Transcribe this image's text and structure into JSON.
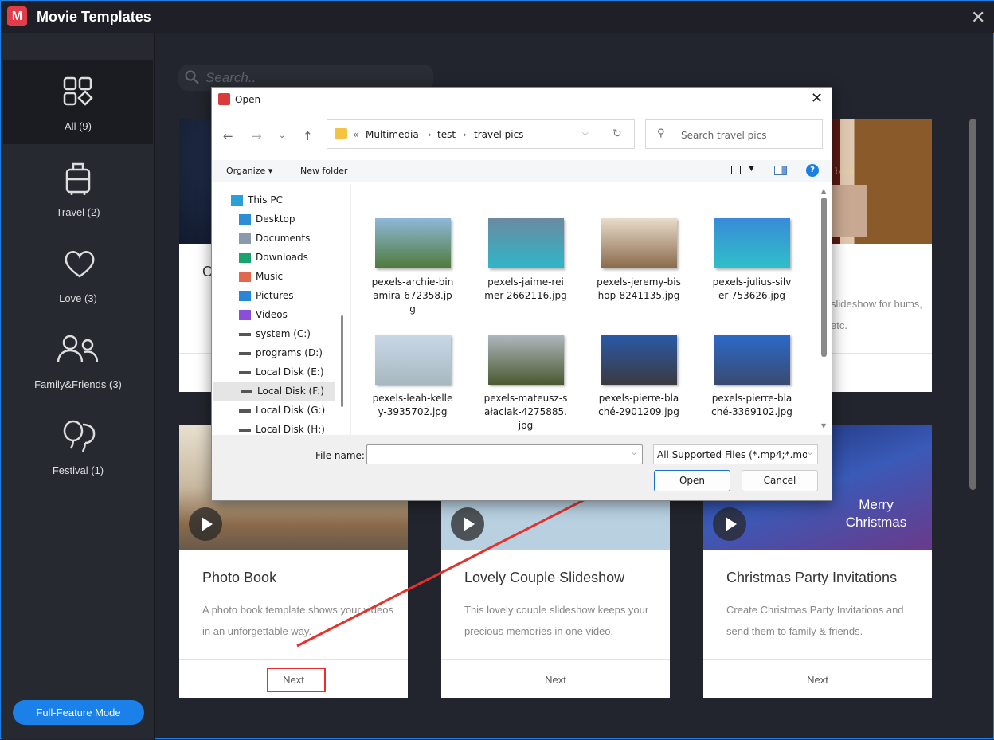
{
  "app": {
    "title": "Movie Templates",
    "close_icon": "close-icon",
    "logo_letter": "M"
  },
  "sidebar": {
    "items": [
      {
        "label": "All   (9)",
        "icon": "grid-icon",
        "selected": true
      },
      {
        "label": "Travel   (2)",
        "icon": "luggage-icon"
      },
      {
        "label": "Love   (3)",
        "icon": "heart-icon"
      },
      {
        "label": "Family&Friends   (3)",
        "icon": "people-icon"
      },
      {
        "label": "Festival   (1)",
        "icon": "balloons-icon"
      }
    ],
    "full_feature_label": "Full-Feature Mode"
  },
  "search": {
    "placeholder": "Search.."
  },
  "cards": [
    {
      "title": "C",
      "desc": "Us te",
      "next": "Next"
    },
    {
      "title": "",
      "desc": "",
      "next": "Next"
    },
    {
      "title": "",
      "desc": "slideshow for bums, etc.",
      "next": "Next"
    },
    {
      "title": "Photo Book",
      "desc": "A photo book template shows your videos in an unforgettable way.",
      "next": "Next"
    },
    {
      "title": "Lovely Couple Slideshow",
      "desc": "This lovely couple slideshow keeps your precious memories in one video.",
      "next": "Next"
    },
    {
      "title": "Christmas Party Invitations",
      "desc": "Create Christmas Party Invitations and send them to family & friends.",
      "next": "Next",
      "overlay": "Merry Christmas"
    }
  ],
  "album_text": "bum",
  "dialog": {
    "title": "Open",
    "breadcrumb": [
      "«",
      "Multimedia",
      "›",
      "test",
      "›",
      "travel pics"
    ],
    "search_placeholder": "Search travel pics",
    "organize": "Organize ▾",
    "new_folder": "New folder",
    "nav": [
      {
        "label": "This PC",
        "color": "#2aa0d8"
      },
      {
        "label": "Desktop",
        "color": "#2b8fd6"
      },
      {
        "label": "Documents",
        "color": "#8a9aab"
      },
      {
        "label": "Downloads",
        "color": "#1aa36f"
      },
      {
        "label": "Music",
        "color": "#e0684e"
      },
      {
        "label": "Pictures",
        "color": "#2a84d8"
      },
      {
        "label": "Videos",
        "color": "#8a4fd8"
      },
      {
        "label": "system (C:)",
        "color": "#555"
      },
      {
        "label": "programs (D:)",
        "color": "#555"
      },
      {
        "label": "Local Disk (E:)",
        "color": "#555"
      },
      {
        "label": "Local Disk (F:)",
        "color": "#555",
        "selected": true
      },
      {
        "label": "Local Disk (G:)",
        "color": "#555"
      },
      {
        "label": "Local Disk (H:)",
        "color": "#555"
      }
    ],
    "files": [
      {
        "name": "pexels-archie-binamira-672358.jpg",
        "colors": [
          "#8fb8d8",
          "#4f7a3a"
        ]
      },
      {
        "name": "pexels-jaime-reimer-2662116.jpg",
        "colors": [
          "#6a8aa0",
          "#2fb6c8"
        ]
      },
      {
        "name": "pexels-jeremy-bishop-8241135.jpg",
        "colors": [
          "#e8dccb",
          "#8a6a4a"
        ]
      },
      {
        "name": "pexels-julius-silver-753626.jpg",
        "colors": [
          "#3a8ad8",
          "#2ec0c8"
        ]
      },
      {
        "name": "pexels-leah-kelley-3935702.jpg",
        "colors": [
          "#c8d8e8",
          "#a8b8c0"
        ]
      },
      {
        "name": "pexels-mateusz-sałaciak-4275885.jpg",
        "colors": [
          "#b0b8c0",
          "#4a5a30"
        ]
      },
      {
        "name": "pexels-pierre-blaché-2901209.jpg",
        "colors": [
          "#2a5aa8",
          "#3a3a40"
        ]
      },
      {
        "name": "pexels-pierre-blaché-3369102.jpg",
        "colors": [
          "#2a6ac8",
          "#3a4a70"
        ]
      }
    ],
    "file_name_label": "File name:",
    "file_name_value": "",
    "file_type": "All Supported Files (*.mp4;*.mo",
    "open_label": "Open",
    "cancel_label": "Cancel"
  },
  "accent": "#1b80e8",
  "annotation_color": "#e5322d"
}
